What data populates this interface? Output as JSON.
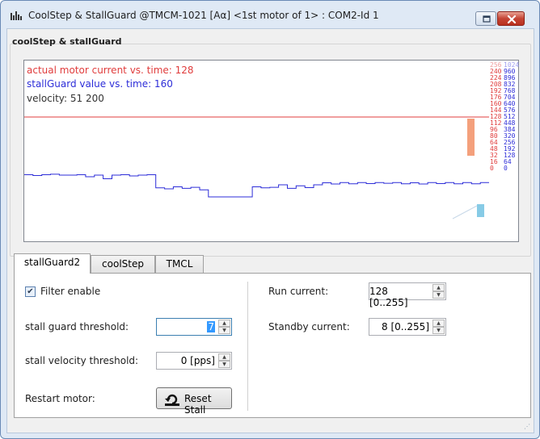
{
  "window": {
    "title": "CoolStep & StallGuard @TMCM-1021 [Aα] <1st motor of 1> : COM2-Id 1",
    "icon": "bar-chart-icon"
  },
  "group": {
    "label": "coolStep & stallGuard"
  },
  "chart": {
    "legend_current": "actual motor current vs. time: 128",
    "legend_stallguard": "stallGuard value vs. time: 160",
    "legend_velocity": "velocity: 51 200",
    "current_scale": [
      "256",
      "240",
      "224",
      "208",
      "192",
      "176",
      "160",
      "144",
      "128",
      "112",
      "96",
      "80",
      "64",
      "48",
      "32",
      "16",
      "0"
    ],
    "stallguard_scale": [
      "1024",
      "960",
      "896",
      "832",
      "768",
      "704",
      "640",
      "576",
      "512",
      "448",
      "384",
      "320",
      "256",
      "192",
      "128",
      "64",
      "0"
    ],
    "colors": {
      "current": "#e03c3c",
      "stallguard": "#2d2dd8",
      "velocity": "#333333"
    }
  },
  "chart_data": {
    "type": "line",
    "series": [
      {
        "name": "actual motor current vs. time",
        "values": [
          128,
          128,
          128,
          128,
          128,
          128
        ]
      },
      {
        "name": "stallGuard value vs. time",
        "values": [
          340,
          332,
          340,
          345,
          336,
          336,
          340,
          320,
          336,
          300,
          336,
          340,
          328,
          336,
          340,
          210,
          200,
          220,
          205,
          215,
          190,
          120,
          120,
          120,
          120,
          120,
          220,
          210,
          215,
          240,
          205,
          230,
          212,
          240,
          260,
          248,
          262,
          250,
          262,
          252,
          262,
          255,
          262,
          250,
          260,
          248,
          262,
          252,
          262,
          250,
          262,
          250,
          262
        ]
      }
    ],
    "bars": {
      "current": 128,
      "stallguard": 160
    },
    "ylim_current": [
      0,
      256
    ],
    "ylim_stallguard": [
      0,
      1024
    ]
  },
  "tabs": [
    "stallGuard2",
    "coolStep",
    "TMCL"
  ],
  "stallguard_tab": {
    "filter_label": "Filter enable",
    "filter_checked": true,
    "threshold_label": "stall guard threshold:",
    "threshold_value": "7",
    "velocity_label": "stall velocity threshold:",
    "velocity_value": "0 [pps]",
    "restart_label": "Restart motor:",
    "reset_button": "Reset Stall",
    "run_current_label": "Run current:",
    "run_current_value": "128 [0..255]",
    "standby_label": "Standby current:",
    "standby_value": "8 [0..255]"
  }
}
